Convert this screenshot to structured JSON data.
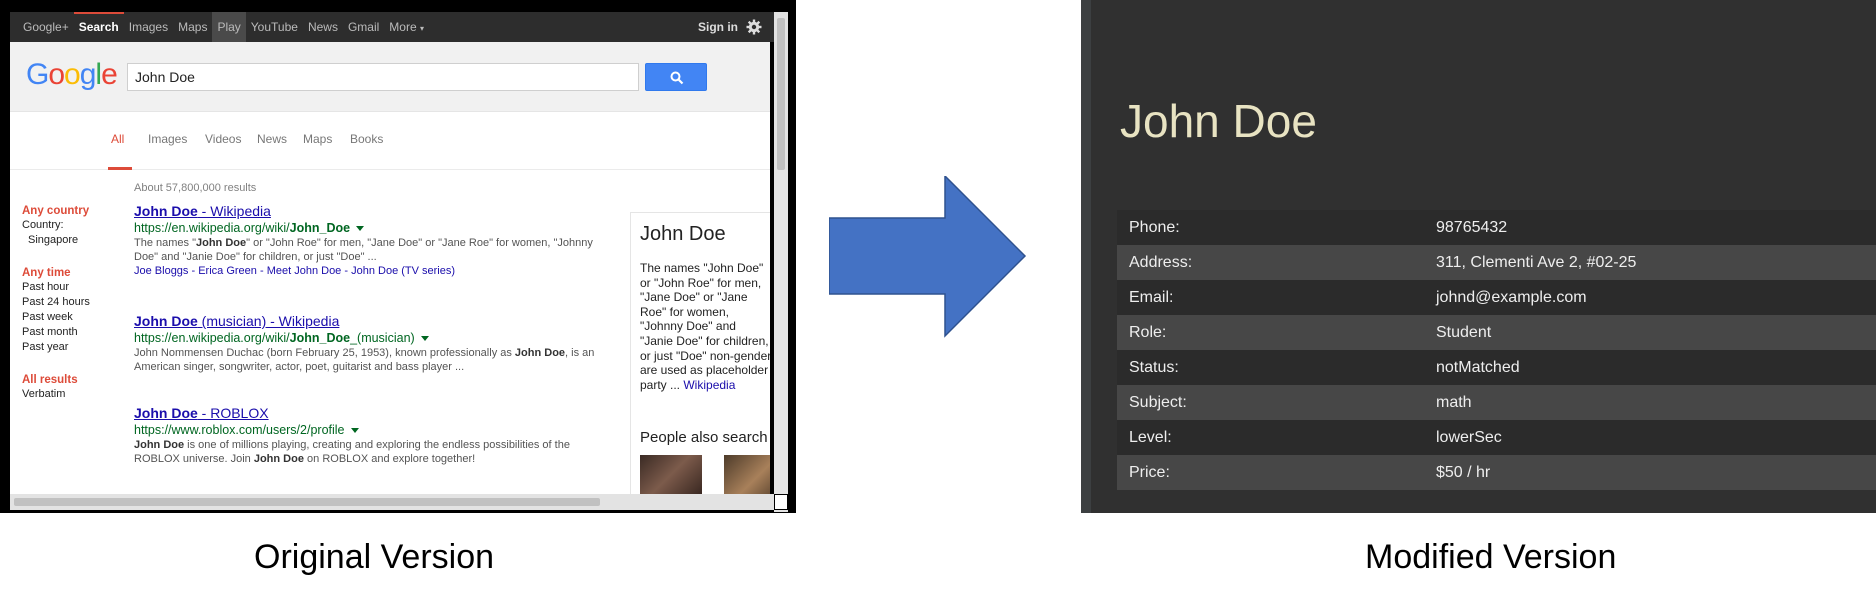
{
  "original": {
    "navbar": {
      "items": [
        "Google+",
        "Search",
        "Images",
        "Maps",
        "Play",
        "YouTube",
        "News",
        "Gmail",
        "More"
      ],
      "sign_in": "Sign in"
    },
    "logo": [
      "G",
      "o",
      "o",
      "g",
      "l",
      "e"
    ],
    "search_value": "John Doe",
    "tabs": [
      "All",
      "Images",
      "Videos",
      "News",
      "Maps",
      "Books"
    ],
    "stats": "About 57,800,000 results",
    "left_nav": {
      "country_heading": "Any country",
      "country_label": "Country:",
      "country_value": "Singapore",
      "time_heading": "Any time",
      "time_options": [
        "Past hour",
        "Past 24 hours",
        "Past week",
        "Past month",
        "Past year"
      ],
      "results_heading": "All results",
      "verbatim": "Verbatim"
    },
    "results": [
      {
        "title_bold": "John Doe",
        "title_rest": " - Wikipedia",
        "url_pre": "https://en.wikipedia.org/wiki/",
        "url_bold": "John_Doe",
        "url_post": "",
        "snippet_l1a": "The names \"",
        "snippet_l1b": "John Doe",
        "snippet_l1c": "\" or \"John Roe\" for men, \"Jane Doe\" or \"Jane Roe\" for women, \"Johnny",
        "snippet_l2": "Doe\" and \"Janie Doe\" for children, or just \"Doe\" ...",
        "links": [
          "Joe Bloggs",
          "Erica Green",
          "Meet John Doe",
          "John Doe (TV series)"
        ]
      },
      {
        "title_bold": "John Doe",
        "title_rest": " (musician) - Wikipedia",
        "url_pre": "https://en.wikipedia.org/wiki/",
        "url_bold": "John_Doe",
        "url_post": "_(musician)",
        "snippet_l1a": "John Nommensen Duchac (born February 25, 1953), known professionally as ",
        "snippet_l1b": "John Doe",
        "snippet_l1c": ", is an",
        "snippet_l2": "American singer, songwriter, actor, poet, guitarist and bass player ..."
      },
      {
        "title_bold": "John Doe",
        "title_rest": " - ROBLOX",
        "url_pre": "https://www.roblox.com/users/2/profile",
        "url_bold": "",
        "url_post": "",
        "snippet_l1a": "",
        "snippet_l1b": "John Doe",
        "snippet_l1c": " is one of millions playing, creating and exploring the endless possibilities of the",
        "snippet_l2a": "ROBLOX universe. Join ",
        "snippet_l2b": "John Doe",
        "snippet_l2c": " on ROBLOX and explore together!"
      }
    ],
    "knowledge_panel": {
      "title": "John Doe",
      "description_lines": [
        "The names \"John Doe\"",
        "or \"John Roe\" for men,",
        "\"Jane Doe\" or \"Jane",
        "Roe\" for women,",
        "\"Johnny Doe\" and",
        "\"Janie Doe\" for children,",
        "or just \"Doe\" non-gender",
        "are used as placeholder",
        "party ..."
      ],
      "source_link": "Wikipedia",
      "people_also_search": "People also search for"
    }
  },
  "modified": {
    "title": "John Doe",
    "fields": [
      {
        "label": "Phone:",
        "value": "98765432"
      },
      {
        "label": "Address:",
        "value": "311, Clementi Ave 2, #02-25"
      },
      {
        "label": "Email:",
        "value": "johnd@example.com"
      },
      {
        "label": "Role:",
        "value": "Student"
      },
      {
        "label": "Status:",
        "value": "notMatched"
      },
      {
        "label": "Subject:",
        "value": "math"
      },
      {
        "label": "Level:",
        "value": "lowerSec"
      },
      {
        "label": "Price:",
        "value": "$50 / hr"
      }
    ]
  },
  "captions": {
    "left": "Original Version",
    "right": "Modified Version"
  },
  "colors": {
    "arrow_fill": "#4472c4",
    "modified_title": "#e8e3c2",
    "google_red": "#dd4b39",
    "link_blue": "#1a0dab",
    "url_green": "#006621"
  }
}
